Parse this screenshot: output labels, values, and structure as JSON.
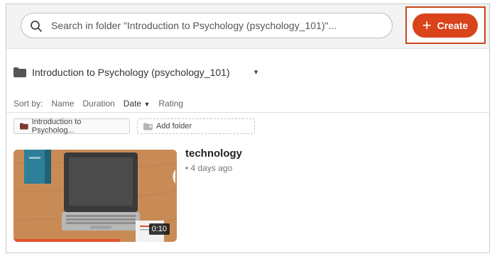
{
  "search": {
    "text": "Search in folder \"Introduction to Psychology (psychology_101)\"..."
  },
  "toolbar": {
    "create_label": "Create",
    "create_icon": "plus-icon",
    "accent": "#d9441a"
  },
  "folder": {
    "name": "Introduction to Psychology (psychology_101)"
  },
  "sort": {
    "prefix": "Sort by:",
    "options": [
      "Name",
      "Duration",
      "Date",
      "Rating"
    ],
    "active": "Date"
  },
  "chips": {
    "folder_label": "Introduction to Psycholog...",
    "add_label": "Add folder"
  },
  "video": {
    "title": "technology",
    "meta": "• 4 days ago",
    "duration": "0:10",
    "progress_fraction": 0.65
  }
}
